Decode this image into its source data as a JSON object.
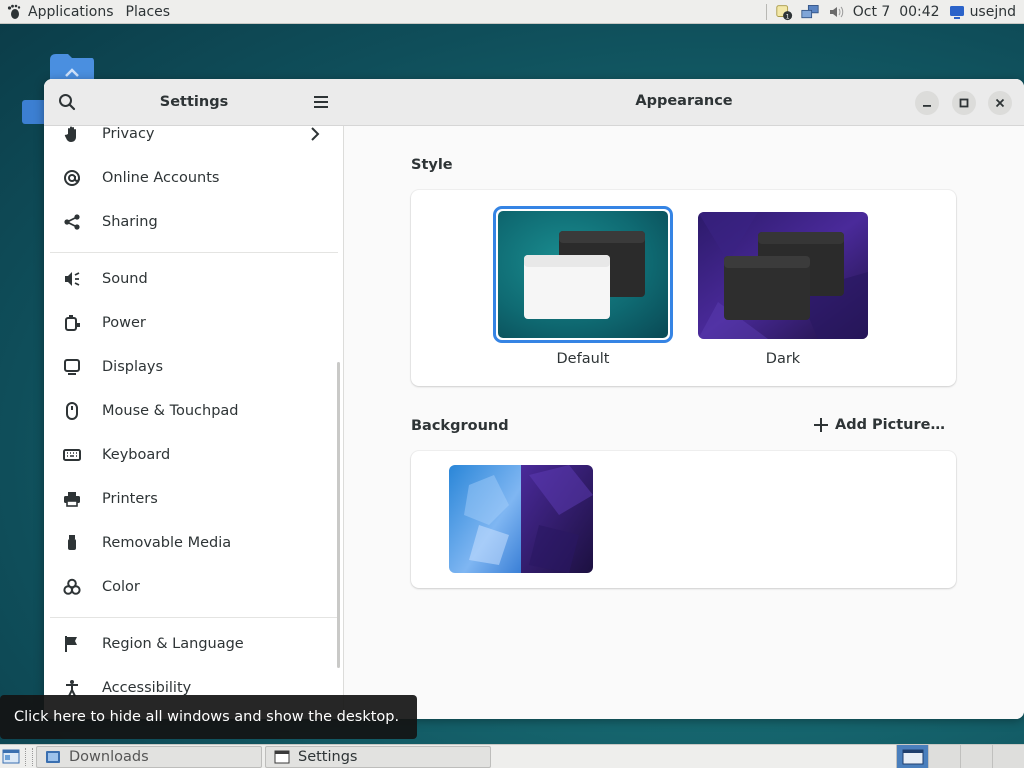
{
  "top_panel": {
    "applications_label": "Applications",
    "places_label": "Places",
    "clock": "Oct 7  00:42",
    "user": "usejnd"
  },
  "settings": {
    "sidebar_title": "Settings",
    "items": [
      {
        "label": "Privacy",
        "icon": "hand-icon"
      },
      {
        "label": "Online Accounts",
        "icon": "at-icon"
      },
      {
        "label": "Sharing",
        "icon": "share-icon"
      },
      {
        "label": "Sound",
        "icon": "speaker-icon"
      },
      {
        "label": "Power",
        "icon": "power-icon"
      },
      {
        "label": "Displays",
        "icon": "display-icon"
      },
      {
        "label": "Mouse & Touchpad",
        "icon": "mouse-icon"
      },
      {
        "label": "Keyboard",
        "icon": "keyboard-icon"
      },
      {
        "label": "Printers",
        "icon": "printer-icon"
      },
      {
        "label": "Removable Media",
        "icon": "usb-icon"
      },
      {
        "label": "Color",
        "icon": "color-icon"
      },
      {
        "label": "Region & Language",
        "icon": "flag-icon"
      },
      {
        "label": "Accessibility",
        "icon": "accessibility-icon"
      }
    ]
  },
  "appearance": {
    "title": "Appearance",
    "style_label": "Style",
    "styles": [
      {
        "label": "Default",
        "selected": true
      },
      {
        "label": "Dark",
        "selected": false
      }
    ],
    "background_label": "Background",
    "add_picture_label": "Add Picture…"
  },
  "tooltip": {
    "text": "Click here to hide all windows and show the desktop."
  },
  "taskbar": {
    "tasks": [
      {
        "label": "Downloads",
        "icon": "folder-icon"
      },
      {
        "label": "Settings",
        "icon": "window-icon"
      }
    ]
  },
  "colors": {
    "accent": "#3584e4",
    "desktop": "#176a72",
    "header_bg": "#ebebeb"
  }
}
